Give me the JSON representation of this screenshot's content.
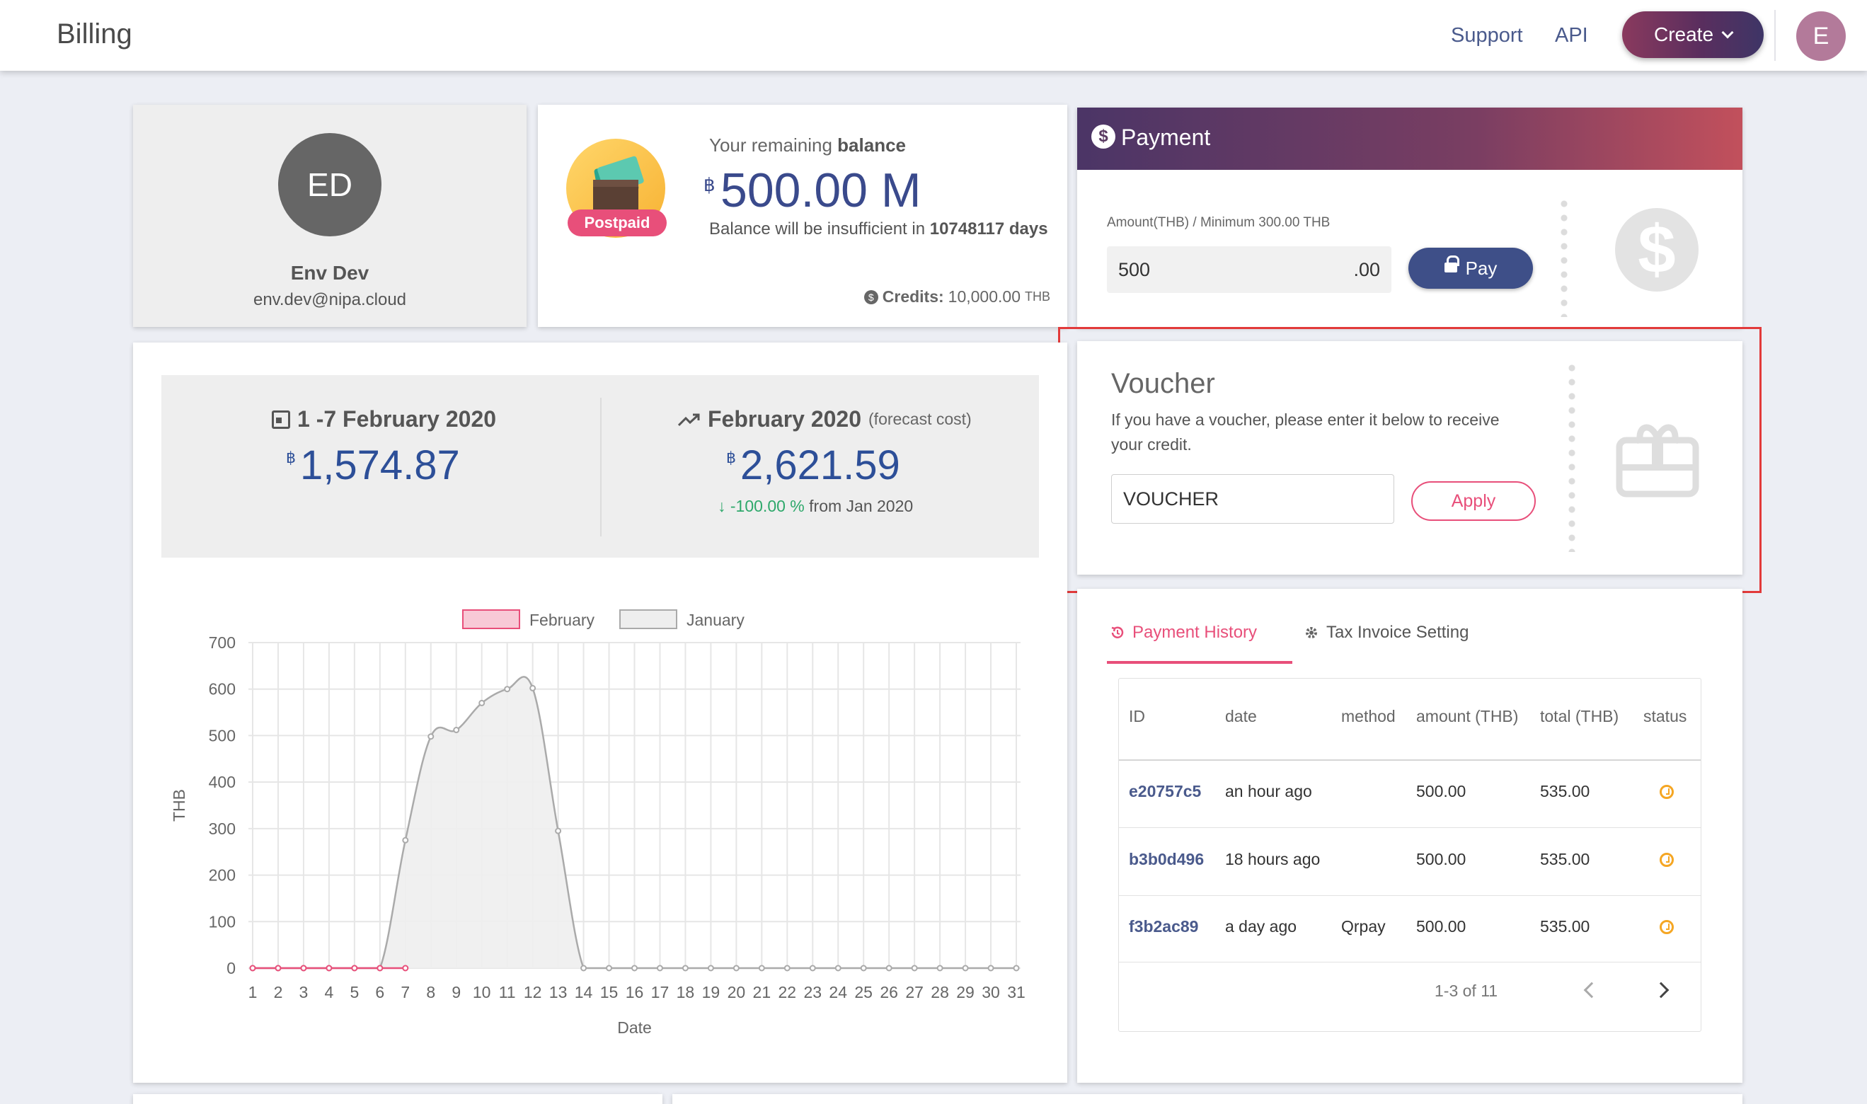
{
  "header": {
    "title": "Billing",
    "links": [
      "Support",
      "API"
    ],
    "create_label": "Create",
    "user_initial": "E"
  },
  "profile": {
    "initials": "ED",
    "name": "Env Dev",
    "email": "env.dev@nipa.cloud"
  },
  "balance": {
    "plan_badge": "Postpaid",
    "label_prefix": "Your remaining",
    "label_strong": "balance",
    "currency_symbol": "฿",
    "amount": "500.00 M",
    "note_prefix": "Balance will be insufficient in",
    "note_days": "10748117 days",
    "credits_label": "Credits:",
    "credits_value": "10,000.00",
    "credits_unit": "THB"
  },
  "payment": {
    "title": "Payment",
    "amount_label": "Amount(THB) / Minimum 300.00 THB",
    "amount_value": "500",
    "amount_decimals": ".00",
    "pay_label": "Pay"
  },
  "voucher": {
    "title": "Voucher",
    "description": "If you have a voucher, please enter it below to receive your credit.",
    "input_value": "VOUCHER",
    "apply_label": "Apply"
  },
  "stats": {
    "period_label": "1 -7 February 2020",
    "period_currency": "฿",
    "period_value": "1,574.87",
    "forecast_label": "February 2020",
    "forecast_sub": "(forecast cost)",
    "forecast_currency": "฿",
    "forecast_value": "2,621.59",
    "change_pct": "-100.00 %",
    "change_suffix": "from Jan 2020",
    "colors": {
      "accent_blue": "#2d4f98",
      "positive_green": "#2ea86b"
    }
  },
  "chart_data": {
    "type": "area",
    "title": "",
    "xlabel": "Date",
    "ylabel": "THB",
    "ylim": [
      0,
      700
    ],
    "y_ticks": [
      0,
      100,
      200,
      300,
      400,
      500,
      600,
      700
    ],
    "x": [
      1,
      2,
      3,
      4,
      5,
      6,
      7,
      8,
      9,
      10,
      11,
      12,
      13,
      14,
      15,
      16,
      17,
      18,
      19,
      20,
      21,
      22,
      23,
      24,
      25,
      26,
      27,
      28,
      29,
      30,
      31
    ],
    "legend": "top",
    "grid": true,
    "series": [
      {
        "name": "February",
        "color": "#e84f7a",
        "fill": "#f8c9d6",
        "values": [
          0,
          0,
          0,
          0,
          0,
          0,
          0
        ]
      },
      {
        "name": "January",
        "color": "#aaaaaa",
        "fill": "#eeeeee",
        "values": [
          0,
          0,
          0,
          0,
          0,
          0,
          275,
          498,
          512,
          570,
          600,
          602,
          295,
          0,
          0,
          0,
          0,
          0,
          0,
          0,
          0,
          0,
          0,
          0,
          0,
          0,
          0,
          0,
          0,
          0,
          0
        ]
      }
    ]
  },
  "tabs": {
    "active": "Payment History",
    "inactive": "Tax Invoice Setting"
  },
  "history": {
    "columns": [
      "ID",
      "date",
      "method",
      "amount (THB)",
      "total (THB)",
      "status"
    ],
    "rows": [
      {
        "id": "e20757c5",
        "date": "an hour ago",
        "method": "",
        "amount": "500.00",
        "total": "535.00"
      },
      {
        "id": "b3b0d496",
        "date": "18 hours ago",
        "method": "",
        "amount": "500.00",
        "total": "535.00"
      },
      {
        "id": "f3b2ac89",
        "date": "a day ago",
        "method": "Qrpay",
        "amount": "500.00",
        "total": "535.00"
      }
    ],
    "pagination": "1-3 of 11"
  }
}
